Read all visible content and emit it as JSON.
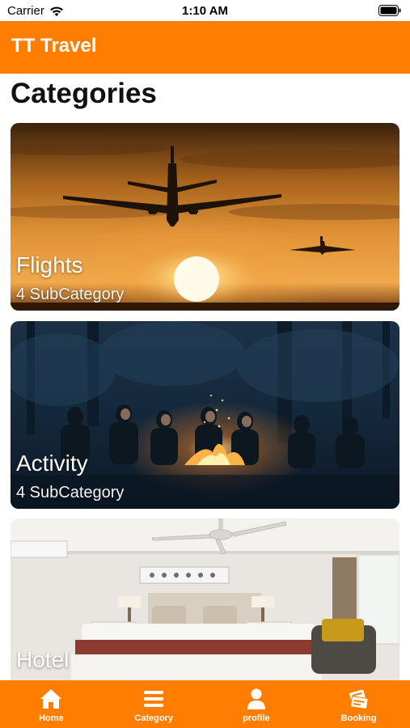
{
  "status_bar": {
    "carrier": "Carrier",
    "time": "1:10 AM"
  },
  "app_bar": {
    "title": "TT Travel"
  },
  "page": {
    "heading": "Categories"
  },
  "categories": [
    {
      "title": "Flights",
      "subtitle": "4 SubCategory"
    },
    {
      "title": "Activity",
      "subtitle": "4 SubCategory"
    },
    {
      "title": "Hotel"
    }
  ],
  "bottom_nav": [
    {
      "label": "Home",
      "icon": "home-icon"
    },
    {
      "label": "Category",
      "icon": "menu-icon"
    },
    {
      "label": "profile",
      "icon": "person-icon"
    },
    {
      "label": "Booking",
      "icon": "tickets-icon"
    }
  ],
  "colors": {
    "accent": "#ff7d00",
    "text_on_accent": "#ffffff"
  }
}
